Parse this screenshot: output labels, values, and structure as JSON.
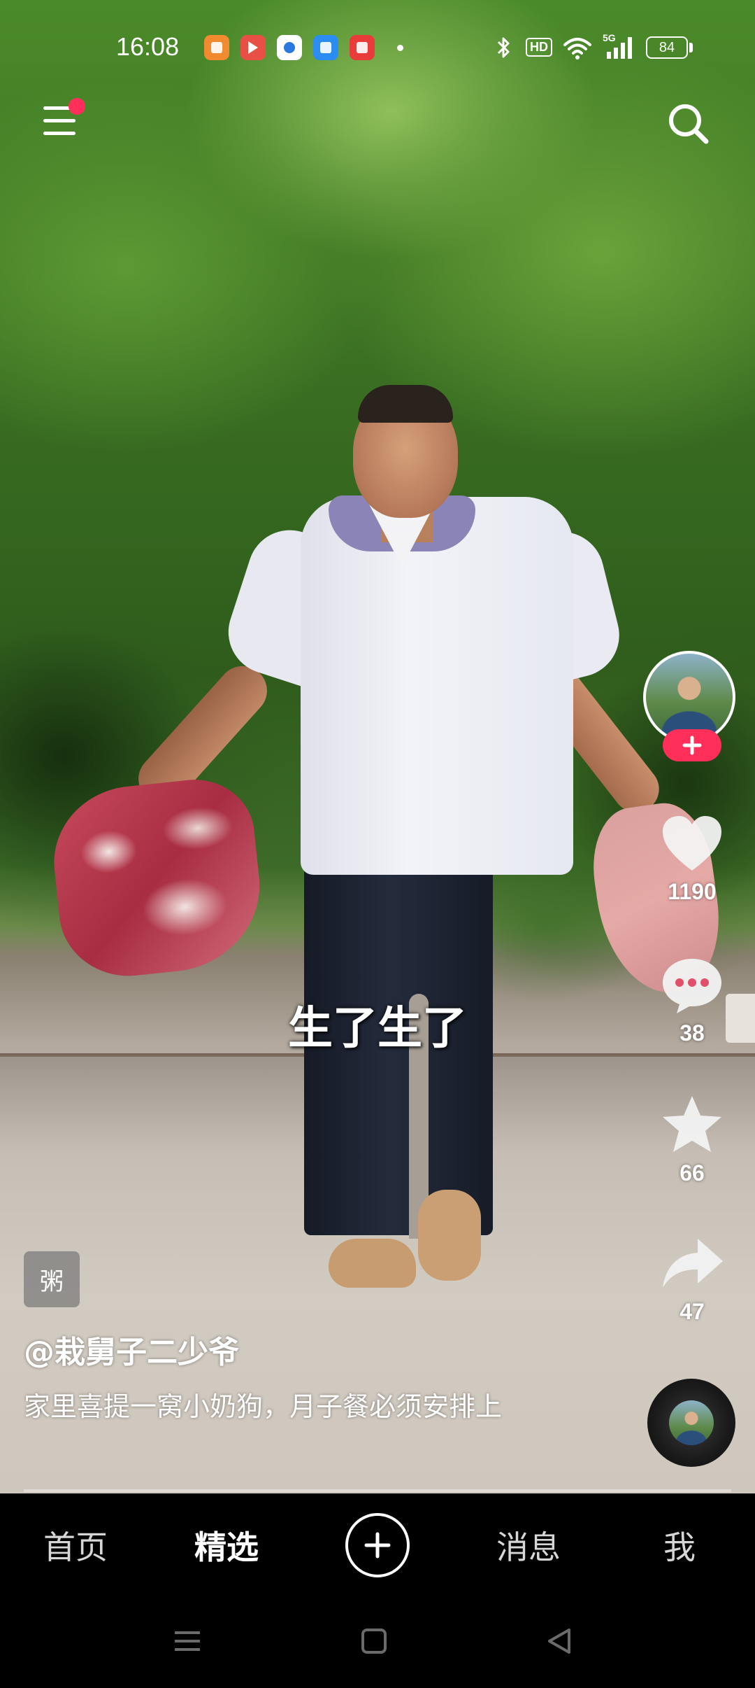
{
  "status_bar": {
    "time": "16:08",
    "network": "5G",
    "hd_label": "HD",
    "battery": "84"
  },
  "notification_apps": [
    "books-app-icon",
    "video-app-icon",
    "browser-app-icon",
    "files-app-icon",
    "music-app-icon"
  ],
  "top_bar": {
    "menu_icon": "hamburger-menu-icon",
    "menu_has_badge": true,
    "search_icon": "search-icon"
  },
  "video": {
    "caption": "生了生了",
    "tag": "粥",
    "author": "@栽舅子二少爷",
    "description": "家里喜提一窝小奶狗，月子餐必须安排上"
  },
  "actions": {
    "follow_icon": "plus-icon",
    "likes": "1190",
    "comments": "38",
    "favorites": "66",
    "shares": "47"
  },
  "bottom_nav": {
    "home": "首页",
    "featured": "精选",
    "create_icon": "plus-circle-icon",
    "messages": "消息",
    "me": "我",
    "active": "featured"
  },
  "colors": {
    "accent": "#ff2f5a",
    "nav_background": "#000000"
  }
}
